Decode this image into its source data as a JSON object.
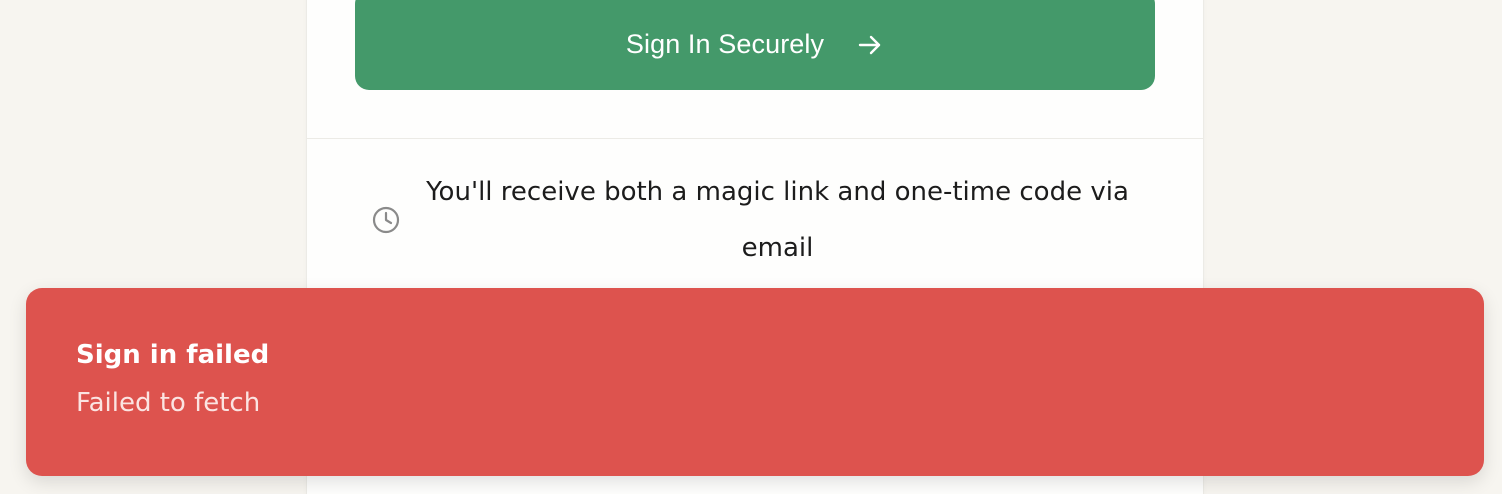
{
  "signin": {
    "button_label": "Sign In Securely",
    "button_color": "#44996a",
    "arrow_icon": "arrow-right-icon"
  },
  "info": {
    "icon": "clock-icon",
    "text": "You'll receive both a magic link and one-time code via email"
  },
  "toast": {
    "title": "Sign in failed",
    "description": "Failed to fetch",
    "color": "#dd534e"
  }
}
